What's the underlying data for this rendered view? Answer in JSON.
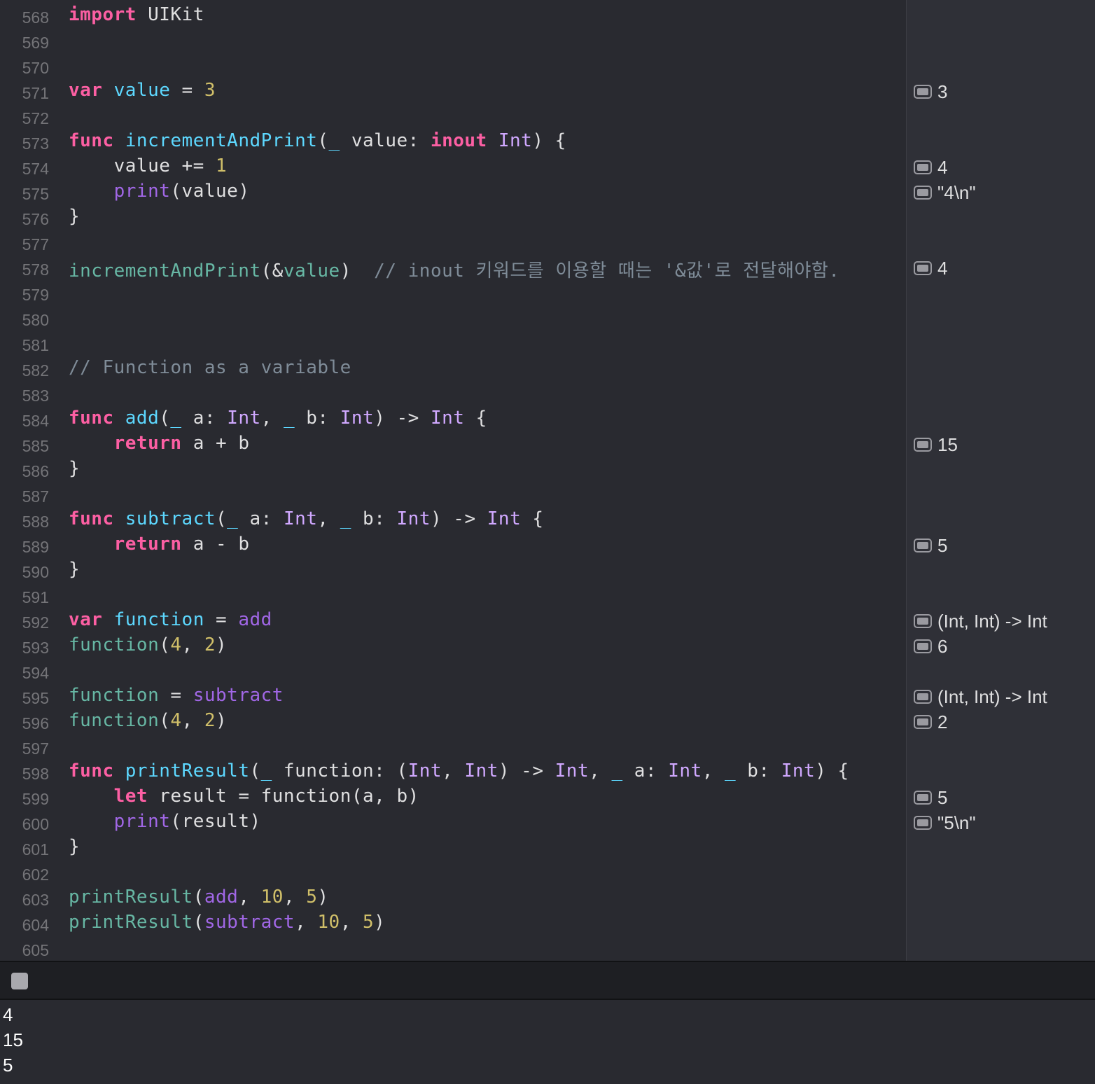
{
  "editor": {
    "lines": [
      {
        "n": "568",
        "tokens": [
          {
            "t": "import",
            "c": "kw"
          },
          {
            "t": " UIKit",
            "c": ""
          }
        ]
      },
      {
        "n": "569",
        "tokens": []
      },
      {
        "n": "570",
        "tokens": []
      },
      {
        "n": "571",
        "tokens": [
          {
            "t": "var",
            "c": "kw"
          },
          {
            "t": " ",
            "c": ""
          },
          {
            "t": "value",
            "c": "id"
          },
          {
            "t": " = ",
            "c": ""
          },
          {
            "t": "3",
            "c": "num"
          }
        ]
      },
      {
        "n": "572",
        "tokens": []
      },
      {
        "n": "573",
        "tokens": [
          {
            "t": "func",
            "c": "kw"
          },
          {
            "t": " ",
            "c": ""
          },
          {
            "t": "incrementAndPrint",
            "c": "id"
          },
          {
            "t": "(",
            "c": ""
          },
          {
            "t": "_",
            "c": "id"
          },
          {
            "t": " value: ",
            "c": ""
          },
          {
            "t": "inout",
            "c": "kw"
          },
          {
            "t": " ",
            "c": ""
          },
          {
            "t": "Int",
            "c": "ty"
          },
          {
            "t": ") {",
            "c": ""
          }
        ]
      },
      {
        "n": "574",
        "tokens": [
          {
            "t": "    value += ",
            "c": ""
          },
          {
            "t": "1",
            "c": "num"
          }
        ]
      },
      {
        "n": "575",
        "tokens": [
          {
            "t": "    ",
            "c": ""
          },
          {
            "t": "print",
            "c": "pf"
          },
          {
            "t": "(value)",
            "c": ""
          }
        ]
      },
      {
        "n": "576",
        "tokens": [
          {
            "t": "}",
            "c": ""
          }
        ]
      },
      {
        "n": "577",
        "tokens": []
      },
      {
        "n": "578",
        "tokens": [
          {
            "t": "incrementAndPrint",
            "c": "fn"
          },
          {
            "t": "(&",
            "c": ""
          },
          {
            "t": "value",
            "c": "fn"
          },
          {
            "t": ")  ",
            "c": ""
          },
          {
            "t": "// inout 키워드를 이용할 때는 '&값'로 전달해야함.",
            "c": "cm"
          }
        ]
      },
      {
        "n": "579",
        "tokens": []
      },
      {
        "n": "580",
        "tokens": []
      },
      {
        "n": "581",
        "tokens": []
      },
      {
        "n": "582",
        "tokens": [
          {
            "t": "// Function as a variable",
            "c": "cm"
          }
        ]
      },
      {
        "n": "583",
        "tokens": []
      },
      {
        "n": "584",
        "tokens": [
          {
            "t": "func",
            "c": "kw"
          },
          {
            "t": " ",
            "c": ""
          },
          {
            "t": "add",
            "c": "id"
          },
          {
            "t": "(",
            "c": ""
          },
          {
            "t": "_",
            "c": "id"
          },
          {
            "t": " a: ",
            "c": ""
          },
          {
            "t": "Int",
            "c": "ty"
          },
          {
            "t": ", ",
            "c": ""
          },
          {
            "t": "_",
            "c": "id"
          },
          {
            "t": " b: ",
            "c": ""
          },
          {
            "t": "Int",
            "c": "ty"
          },
          {
            "t": ") -> ",
            "c": ""
          },
          {
            "t": "Int",
            "c": "ty"
          },
          {
            "t": " {",
            "c": ""
          }
        ]
      },
      {
        "n": "585",
        "tokens": [
          {
            "t": "    ",
            "c": ""
          },
          {
            "t": "return",
            "c": "kw"
          },
          {
            "t": " a + b",
            "c": ""
          }
        ]
      },
      {
        "n": "586",
        "tokens": [
          {
            "t": "}",
            "c": ""
          }
        ]
      },
      {
        "n": "587",
        "tokens": []
      },
      {
        "n": "588",
        "tokens": [
          {
            "t": "func",
            "c": "kw"
          },
          {
            "t": " ",
            "c": ""
          },
          {
            "t": "subtract",
            "c": "id"
          },
          {
            "t": "(",
            "c": ""
          },
          {
            "t": "_",
            "c": "id"
          },
          {
            "t": " a: ",
            "c": ""
          },
          {
            "t": "Int",
            "c": "ty"
          },
          {
            "t": ", ",
            "c": ""
          },
          {
            "t": "_",
            "c": "id"
          },
          {
            "t": " b: ",
            "c": ""
          },
          {
            "t": "Int",
            "c": "ty"
          },
          {
            "t": ") -> ",
            "c": ""
          },
          {
            "t": "Int",
            "c": "ty"
          },
          {
            "t": " {",
            "c": ""
          }
        ]
      },
      {
        "n": "589",
        "tokens": [
          {
            "t": "    ",
            "c": ""
          },
          {
            "t": "return",
            "c": "kw"
          },
          {
            "t": " a - b",
            "c": ""
          }
        ]
      },
      {
        "n": "590",
        "tokens": [
          {
            "t": "}",
            "c": ""
          }
        ]
      },
      {
        "n": "591",
        "tokens": []
      },
      {
        "n": "592",
        "tokens": [
          {
            "t": "var",
            "c": "kw"
          },
          {
            "t": " ",
            "c": ""
          },
          {
            "t": "function",
            "c": "id"
          },
          {
            "t": " = ",
            "c": ""
          },
          {
            "t": "add",
            "c": "pf"
          }
        ]
      },
      {
        "n": "593",
        "tokens": [
          {
            "t": "function",
            "c": "fn"
          },
          {
            "t": "(",
            "c": ""
          },
          {
            "t": "4",
            "c": "num"
          },
          {
            "t": ", ",
            "c": ""
          },
          {
            "t": "2",
            "c": "num"
          },
          {
            "t": ")",
            "c": ""
          }
        ]
      },
      {
        "n": "594",
        "tokens": []
      },
      {
        "n": "595",
        "tokens": [
          {
            "t": "function",
            "c": "fn"
          },
          {
            "t": " = ",
            "c": ""
          },
          {
            "t": "subtract",
            "c": "pf"
          }
        ]
      },
      {
        "n": "596",
        "tokens": [
          {
            "t": "function",
            "c": "fn"
          },
          {
            "t": "(",
            "c": ""
          },
          {
            "t": "4",
            "c": "num"
          },
          {
            "t": ", ",
            "c": ""
          },
          {
            "t": "2",
            "c": "num"
          },
          {
            "t": ")",
            "c": ""
          }
        ]
      },
      {
        "n": "597",
        "tokens": []
      },
      {
        "n": "598",
        "tokens": [
          {
            "t": "func",
            "c": "kw"
          },
          {
            "t": " ",
            "c": ""
          },
          {
            "t": "printResult",
            "c": "id"
          },
          {
            "t": "(",
            "c": ""
          },
          {
            "t": "_",
            "c": "id"
          },
          {
            "t": " function: (",
            "c": ""
          },
          {
            "t": "Int",
            "c": "ty"
          },
          {
            "t": ", ",
            "c": ""
          },
          {
            "t": "Int",
            "c": "ty"
          },
          {
            "t": ") -> ",
            "c": ""
          },
          {
            "t": "Int",
            "c": "ty"
          },
          {
            "t": ", ",
            "c": ""
          },
          {
            "t": "_",
            "c": "id"
          },
          {
            "t": " a: ",
            "c": ""
          },
          {
            "t": "Int",
            "c": "ty"
          },
          {
            "t": ", ",
            "c": ""
          },
          {
            "t": "_",
            "c": "id"
          },
          {
            "t": " b: ",
            "c": ""
          },
          {
            "t": "Int",
            "c": "ty"
          },
          {
            "t": ") {",
            "c": ""
          }
        ]
      },
      {
        "n": "599",
        "tokens": [
          {
            "t": "    ",
            "c": ""
          },
          {
            "t": "let",
            "c": "kw"
          },
          {
            "t": " result = function(a, b)",
            "c": ""
          }
        ]
      },
      {
        "n": "600",
        "tokens": [
          {
            "t": "    ",
            "c": ""
          },
          {
            "t": "print",
            "c": "pf"
          },
          {
            "t": "(result)",
            "c": ""
          }
        ]
      },
      {
        "n": "601",
        "tokens": [
          {
            "t": "}",
            "c": ""
          }
        ]
      },
      {
        "n": "602",
        "tokens": []
      },
      {
        "n": "603",
        "tokens": [
          {
            "t": "printResult",
            "c": "fn"
          },
          {
            "t": "(",
            "c": ""
          },
          {
            "t": "add",
            "c": "pf"
          },
          {
            "t": ", ",
            "c": ""
          },
          {
            "t": "10",
            "c": "num"
          },
          {
            "t": ", ",
            "c": ""
          },
          {
            "t": "5",
            "c": "num"
          },
          {
            "t": ")",
            "c": ""
          }
        ]
      },
      {
        "n": "604",
        "tokens": [
          {
            "t": "printResult",
            "c": "fn"
          },
          {
            "t": "(",
            "c": ""
          },
          {
            "t": "subtract",
            "c": "pf"
          },
          {
            "t": ", ",
            "c": ""
          },
          {
            "t": "10",
            "c": "num"
          },
          {
            "t": ", ",
            "c": ""
          },
          {
            "t": "5",
            "c": "num"
          },
          {
            "t": ")",
            "c": ""
          }
        ]
      },
      {
        "n": "605",
        "tokens": []
      }
    ]
  },
  "results": [
    {
      "line": "571",
      "value": "3"
    },
    {
      "line": "574",
      "value": "4"
    },
    {
      "line": "575",
      "value": "\"4\\n\""
    },
    {
      "line": "578",
      "value": "4"
    },
    {
      "line": "585",
      "value": "15"
    },
    {
      "line": "589",
      "value": "5"
    },
    {
      "line": "592",
      "value": "(Int, Int) -> Int"
    },
    {
      "line": "593",
      "value": "6"
    },
    {
      "line": "595",
      "value": "(Int, Int) -> Int"
    },
    {
      "line": "596",
      "value": "2"
    },
    {
      "line": "599",
      "value": "5"
    },
    {
      "line": "600",
      "value": "\"5\\n\""
    }
  ],
  "console": {
    "output": [
      "4",
      "15",
      "5"
    ]
  },
  "colors": {
    "background": "#292a30",
    "keyword": "#fc5fa3",
    "type": "#d0a8ff",
    "declaration": "#5dd8ff",
    "function_call": "#67b7a4",
    "number": "#d0bf69",
    "comment": "#7f8c98"
  }
}
